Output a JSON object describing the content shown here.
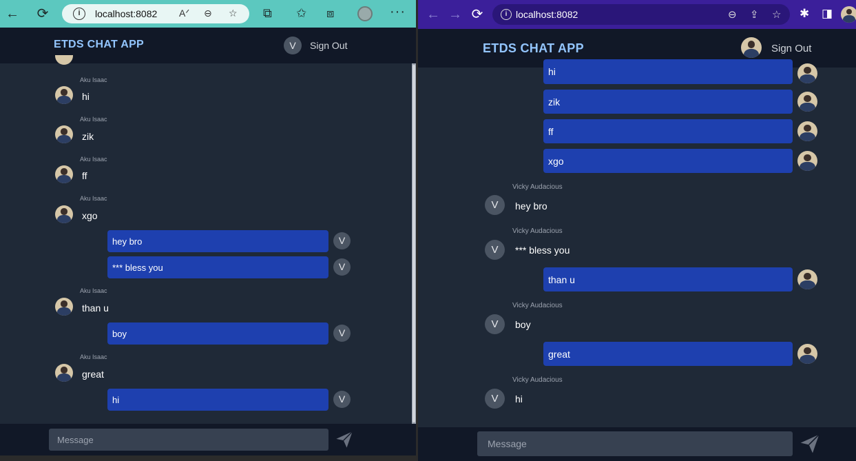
{
  "left_browser": {
    "url": "localhost:8082",
    "icons": [
      "back-arrow-icon",
      "refresh-icon",
      "info-icon",
      "read-aloud-icon",
      "zoom-out-icon",
      "add-favorite-icon",
      "extensions-icon",
      "favorites-icon",
      "collections-icon",
      "profile-icon",
      "more-icon"
    ],
    "glyphs": {
      "back": "←",
      "refresh": "⟳",
      "info": "i",
      "read_aloud": "Aᐟ",
      "zoom": "⊖",
      "star": "☆",
      "extensions": "⧉",
      "favorites": "✩",
      "collections": "⧈",
      "more": "···"
    }
  },
  "right_browser": {
    "url": "localhost:8082",
    "glyphs": {
      "back": "←",
      "forward": "→",
      "refresh": "⟳",
      "info": "i",
      "zoom": "⊖",
      "share": "⇪",
      "star": "☆",
      "extensions": "✱",
      "sidebar": "◨"
    }
  },
  "app": {
    "brand": "ETDS CHAT APP",
    "sign_out": "Sign Out",
    "user_initial": "V",
    "message_placeholder": "Message",
    "colors": {
      "brand": "#93c5fd",
      "bubble": "#1e40af",
      "background": "#1f2937",
      "header": "#111827",
      "input": "#374151"
    }
  },
  "left_chat": {
    "messages": [
      {
        "type": "received",
        "sender": "Aku Isaac",
        "text": "hi"
      },
      {
        "type": "received",
        "sender": "Aku Isaac",
        "text": "zik"
      },
      {
        "type": "received",
        "sender": "Aku Isaac",
        "text": "ff"
      },
      {
        "type": "received",
        "sender": "Aku Isaac",
        "text": "xgo"
      },
      {
        "type": "sent",
        "text": "hey bro"
      },
      {
        "type": "sent",
        "text": "*** bless you"
      },
      {
        "type": "received",
        "sender": "Aku Isaac",
        "text": "than u"
      },
      {
        "type": "sent",
        "text": "boy"
      },
      {
        "type": "received",
        "sender": "Aku Isaac",
        "text": "great"
      },
      {
        "type": "sent",
        "text": "hi"
      }
    ]
  },
  "right_chat": {
    "messages": [
      {
        "type": "sent",
        "text": "hi"
      },
      {
        "type": "sent",
        "text": "zik"
      },
      {
        "type": "sent",
        "text": "ff"
      },
      {
        "type": "sent",
        "text": "xgo"
      },
      {
        "type": "received",
        "sender": "Vicky Audacious",
        "text": "hey bro"
      },
      {
        "type": "received",
        "sender": "Vicky Audacious",
        "text": "*** bless you"
      },
      {
        "type": "sent",
        "text": "than u"
      },
      {
        "type": "received",
        "sender": "Vicky Audacious",
        "text": "boy"
      },
      {
        "type": "sent",
        "text": "great"
      },
      {
        "type": "received",
        "sender": "Vicky Audacious",
        "text": "hi"
      }
    ]
  }
}
